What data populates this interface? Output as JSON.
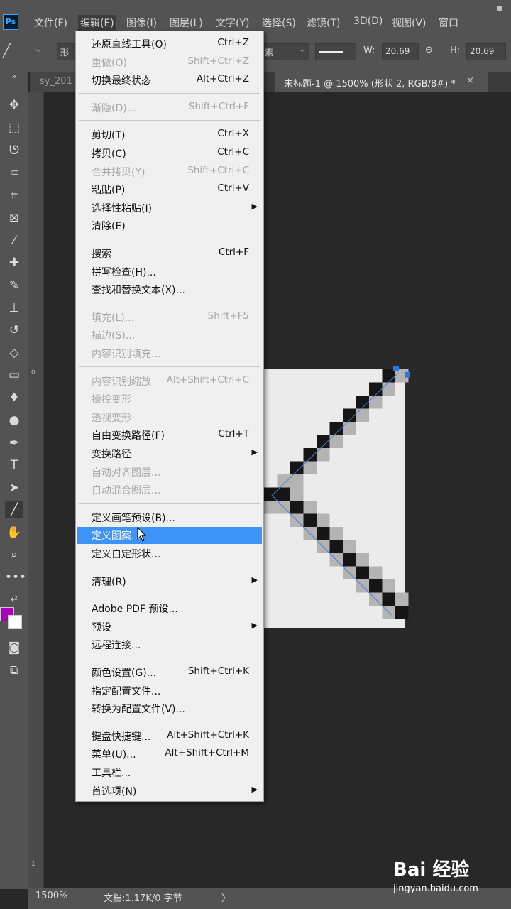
{
  "menubar": {
    "logo": "Ps",
    "items": [
      "文件(F)",
      "编辑(E)",
      "图像(I)",
      "图层(L)",
      "文字(Y)",
      "选择(S)",
      "滤镜(T)",
      "3D(D)",
      "视图(V)",
      "窗口"
    ]
  },
  "optbar": {
    "shape_label": "形",
    "fill_label": "素",
    "w_label": "W:",
    "w_value": "20.69",
    "h_label": "H:",
    "h_value": "20.69"
  },
  "tabs": [
    {
      "label": "sy_201"
    },
    {
      "label": "未标题-1 @ 1500% (形状 2, RGB/8#) *"
    }
  ],
  "tab_close": "×",
  "ruler": {
    "zero": "0",
    "one": "1"
  },
  "edit_menu": {
    "groups": [
      [
        {
          "label": "还原直线工具(O)",
          "shortcut": "Ctrl+Z",
          "enabled": true
        },
        {
          "label": "重做(O)",
          "shortcut": "Shift+Ctrl+Z",
          "enabled": false
        },
        {
          "label": "切换最终状态",
          "shortcut": "Alt+Ctrl+Z",
          "enabled": true
        }
      ],
      [
        {
          "label": "渐隐(D)...",
          "shortcut": "Shift+Ctrl+F",
          "enabled": false
        }
      ],
      [
        {
          "label": "剪切(T)",
          "shortcut": "Ctrl+X",
          "enabled": true
        },
        {
          "label": "拷贝(C)",
          "shortcut": "Ctrl+C",
          "enabled": true
        },
        {
          "label": "合并拷贝(Y)",
          "shortcut": "Shift+Ctrl+C",
          "enabled": false
        },
        {
          "label": "粘贴(P)",
          "shortcut": "Ctrl+V",
          "enabled": true
        },
        {
          "label": "选择性粘贴(I)",
          "shortcut": "",
          "enabled": true,
          "submenu": true
        },
        {
          "label": "清除(E)",
          "shortcut": "",
          "enabled": true
        }
      ],
      [
        {
          "label": "搜索",
          "shortcut": "Ctrl+F",
          "enabled": true
        },
        {
          "label": "拼写检查(H)...",
          "shortcut": "",
          "enabled": true
        },
        {
          "label": "查找和替换文本(X)...",
          "shortcut": "",
          "enabled": true
        }
      ],
      [
        {
          "label": "填充(L)...",
          "shortcut": "Shift+F5",
          "enabled": false
        },
        {
          "label": "描边(S)...",
          "shortcut": "",
          "enabled": false
        },
        {
          "label": "内容识别填充...",
          "shortcut": "",
          "enabled": false
        }
      ],
      [
        {
          "label": "内容识别缩放",
          "shortcut": "Alt+Shift+Ctrl+C",
          "enabled": false
        },
        {
          "label": "操控变形",
          "shortcut": "",
          "enabled": false
        },
        {
          "label": "透视变形",
          "shortcut": "",
          "enabled": false
        },
        {
          "label": "自由变换路径(F)",
          "shortcut": "Ctrl+T",
          "enabled": true
        },
        {
          "label": "变换路径",
          "shortcut": "",
          "enabled": true,
          "submenu": true
        },
        {
          "label": "自动对齐图层...",
          "shortcut": "",
          "enabled": false
        },
        {
          "label": "自动混合图层...",
          "shortcut": "",
          "enabled": false
        }
      ],
      [
        {
          "label": "定义画笔预设(B)...",
          "shortcut": "",
          "enabled": true
        },
        {
          "label": "定义图案...",
          "shortcut": "",
          "enabled": true,
          "highlighted": true
        },
        {
          "label": "定义自定形状...",
          "shortcut": "",
          "enabled": true
        }
      ],
      [
        {
          "label": "清理(R)",
          "shortcut": "",
          "enabled": true,
          "submenu": true
        }
      ],
      [
        {
          "label": "Adobe PDF 预设...",
          "shortcut": "",
          "enabled": true
        },
        {
          "label": "预设",
          "shortcut": "",
          "enabled": true,
          "submenu": true
        },
        {
          "label": "远程连接...",
          "shortcut": "",
          "enabled": true
        }
      ],
      [
        {
          "label": "颜色设置(G)...",
          "shortcut": "Shift+Ctrl+K",
          "enabled": true
        },
        {
          "label": "指定配置文件...",
          "shortcut": "",
          "enabled": true
        },
        {
          "label": "转换为配置文件(V)...",
          "shortcut": "",
          "enabled": true
        }
      ],
      [
        {
          "label": "键盘快捷键...",
          "shortcut": "Alt+Shift+Ctrl+K",
          "enabled": true
        },
        {
          "label": "菜单(U)...",
          "shortcut": "Alt+Shift+Ctrl+M",
          "enabled": true
        },
        {
          "label": "工具栏...",
          "shortcut": "",
          "enabled": true
        },
        {
          "label": "首选项(N)",
          "shortcut": "",
          "enabled": true,
          "submenu": true
        }
      ]
    ]
  },
  "statusbar": {
    "zoom": "1500%",
    "doc_info": "文档:1.17K/0 字节",
    "arrow": "〉"
  },
  "watermark": {
    "logo": "Bai 经验",
    "url": "jingyan.baidu.com"
  },
  "colors": {
    "foreground": "#a800b8",
    "background": "#ffffff",
    "highlight": "#3d94f6"
  }
}
